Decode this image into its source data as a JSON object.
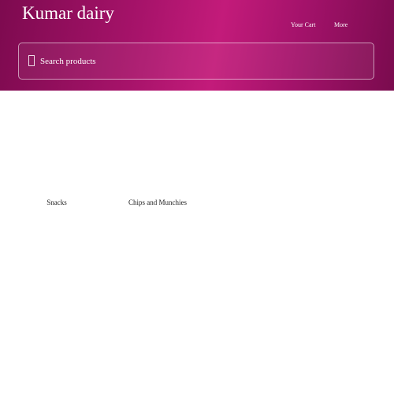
{
  "header": {
    "title": "Kumar dairy",
    "nav": {
      "cart_label": "Your Cart",
      "more_label": "More"
    },
    "search": {
      "placeholder": "Search products",
      "icon": "search-icon"
    },
    "colors": {
      "gradient_dark": "#7d0a4f",
      "gradient_light": "#c31b7a"
    }
  },
  "categories": [
    {
      "label": "Snacks"
    },
    {
      "label": "Chips and Munchies"
    }
  ]
}
